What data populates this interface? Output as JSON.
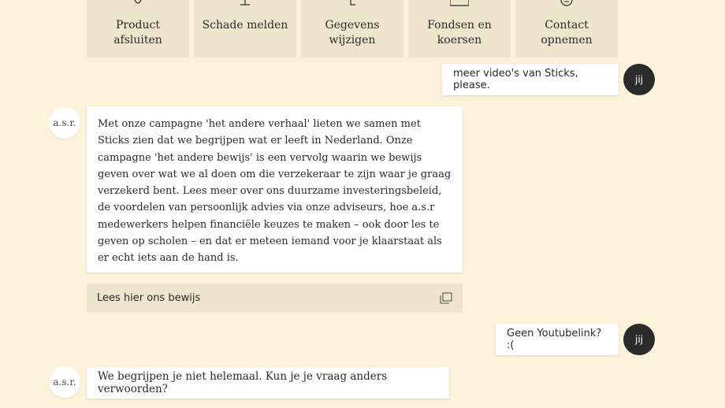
{
  "tiles": [
    {
      "label": "Product\nafsluiten",
      "icon": "product-icon"
    },
    {
      "label": "Schade melden",
      "icon": "damage-icon"
    },
    {
      "label": "Gegevens\nwijzigen",
      "icon": "edit-data-icon"
    },
    {
      "label": "Fondsen en\nkoersen",
      "icon": "funds-icon"
    },
    {
      "label": "Contact\nopnemen",
      "icon": "contact-icon"
    }
  ],
  "chat": {
    "user_avatar": "jij",
    "bot_avatar": "a.s.r.",
    "user_message_1": "meer video's van Sticks, please.",
    "bot_message_1": "Met onze campagne 'het andere verhaal' lieten we samen met Sticks zien dat we begrijpen wat er leeft in Nederland. Onze campagne 'het andere bewijs' is een vervolg waarin we bewijs geven over wat we al doen om die verzekeraar te zijn waar je graag verzekerd bent. Lees meer over ons duurzame investeringsbeleid, de voordelen van persoonlijk advies via onze adviseurs, hoe a.s.r medewerkers helpen financiële keuzes te maken – ook door les te geven op scholen – en dat er meteen iemand voor je klaarstaat als er echt iets aan de hand is.",
    "bot_link_label": "Lees hier ons bewijs",
    "bot_link_icon": "external-link-icon",
    "user_message_2": "Geen Youtubelink? :(",
    "bot_message_2": "We begrijpen je niet helemaal. Kun je je vraag anders verwoorden?"
  },
  "colors": {
    "background": "#fdf3da",
    "tile": "#efe5cc",
    "bubble": "#ffffff",
    "user_avatar_bg": "#2b2b2b"
  }
}
